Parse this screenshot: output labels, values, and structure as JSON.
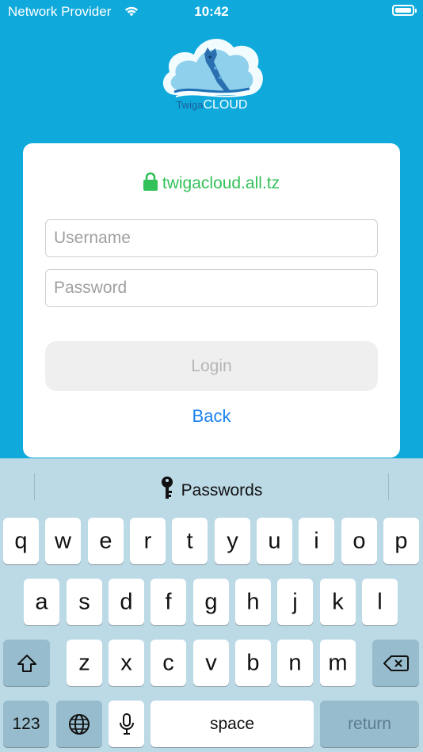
{
  "status": {
    "carrier": "Network Provider",
    "time": "10:42"
  },
  "logo": {
    "text_twiga": "Twiga",
    "text_cloud": "CLOUD"
  },
  "card": {
    "domain": "twigacloud.all.tz",
    "username_placeholder": "Username",
    "password_placeholder": "Password",
    "login_label": "Login",
    "back_label": "Back"
  },
  "keyboard": {
    "passwords_label": "Passwords",
    "row1": [
      "q",
      "w",
      "e",
      "r",
      "t",
      "y",
      "u",
      "i",
      "o",
      "p"
    ],
    "row2": [
      "a",
      "s",
      "d",
      "f",
      "g",
      "h",
      "j",
      "k",
      "l"
    ],
    "row3": [
      "z",
      "x",
      "c",
      "v",
      "b",
      "n",
      "m"
    ],
    "numbers_label": "123",
    "space_label": "space",
    "return_label": "return"
  }
}
